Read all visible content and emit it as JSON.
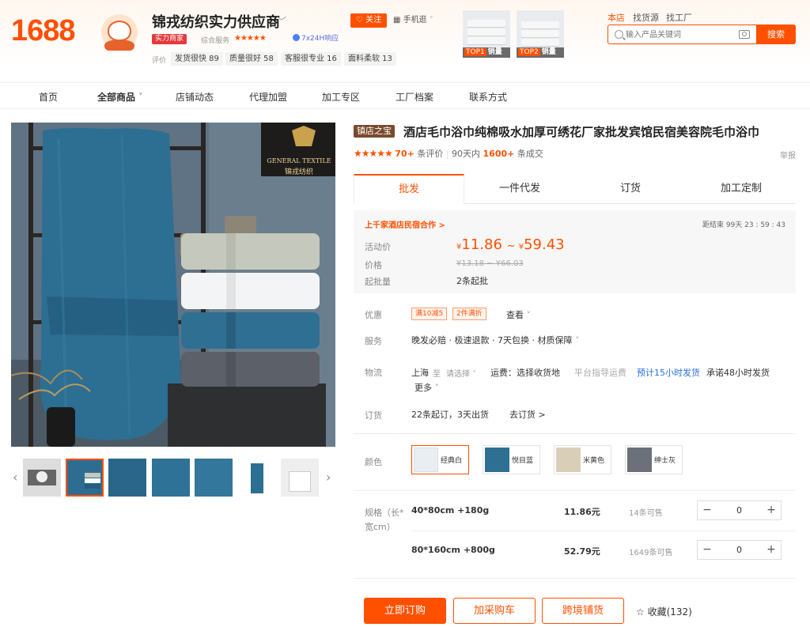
{
  "header": {
    "logo": "1688",
    "shop_name": "锦戎纺织实力供应商",
    "tag_power": "实力商家",
    "composite_label": "综合服务",
    "composite_stars": "★★★★★",
    "badge_response": "7x24H响应",
    "rating_label": "评价",
    "ratings": [
      "发货很快 89",
      "质量很好 58",
      "客服很专业 16",
      "面料柔软 13"
    ],
    "follow": "♡ 关注",
    "mobile": "手机逛",
    "top_products": [
      {
        "rank": "TOP1",
        "label": "销量"
      },
      {
        "rank": "TOP2",
        "label": "销量"
      }
    ],
    "search_tabs": [
      "本店",
      "找货源",
      "找工厂"
    ],
    "search_placeholder": "输入产品关键词",
    "search_button": "搜索"
  },
  "nav": {
    "items": [
      "首页",
      "全部商品",
      "店铺动态",
      "代理加盟",
      "加工专区",
      "工厂档案",
      "联系方式"
    ]
  },
  "gallery": {
    "brand_logo_line1": "GENERAL TEXTILE",
    "brand_logo_line2": "锦戎纺织"
  },
  "product": {
    "tag": "镇店之宝",
    "title": "酒店毛巾浴巾纯棉吸水加厚可绣花厂家批发宾馆民宿美容院毛巾浴巾",
    "stars": "★★★★★",
    "review_count": "70+",
    "review_label": "条评价",
    "sales_period": "90天内",
    "sales_count": "1600+",
    "sales_label": "条成交",
    "report": "举报",
    "tabs": [
      "批发",
      "一件代发",
      "订货",
      "加工定制"
    ],
    "promo_link": "上千家酒店民宿合作 >",
    "countdown": "距结束  99天 23 : 59 : 43",
    "activity_price_label": "活动价",
    "currency": "¥",
    "price_low": "11.86",
    "price_sep": "~",
    "price_high": "59.43",
    "price_label": "价格",
    "old_price": "¥13.18 ~ ¥66.03",
    "min_order_label": "起批量",
    "min_order": "2条起批",
    "discount_label": "优惠",
    "discount_chips": [
      "满10减5",
      "2件满折"
    ],
    "discount_more": "查看",
    "service_label": "服务",
    "service_text": "晚发必赔 · 极速退款 · 7天包换 · 材质保障",
    "logistics_label": "物流",
    "ship_from": "上海",
    "ship_to_word": "至",
    "ship_select": "请选择",
    "freight": "运费：选择收货地",
    "freight_extra": "平台指导运费",
    "ship_promise_blue": "预计15小时发货",
    "ship_promise": "承诺48小时发货",
    "more": "更多",
    "order_label": "订货",
    "order_text": "22条起订，3天出货",
    "order_link": "去订货 >",
    "color_label": "颜色",
    "colors": [
      {
        "name": "经典白",
        "swatch": "#e9eef2"
      },
      {
        "name": "悦目蓝",
        "swatch": "#2f6f92"
      },
      {
        "name": "米黄色",
        "swatch": "#d9cfb9"
      },
      {
        "name": "绅士灰",
        "swatch": "#6b7079"
      }
    ],
    "spec_label_1": "规格（长*",
    "spec_label_2": "宽cm）",
    "specs": [
      {
        "name": "40*80cm +180g",
        "price": "11.86元",
        "stock": "14条可售",
        "qty": "0"
      },
      {
        "name": "80*160cm +800g",
        "price": "52.79元",
        "stock": "1649条可售",
        "qty": "0"
      }
    ],
    "btn_order": "立即订购",
    "btn_cart": "加采购车",
    "btn_cross": "跨境铺货",
    "favorite": "☆ 收藏(132)",
    "accent": "#ff5000"
  }
}
